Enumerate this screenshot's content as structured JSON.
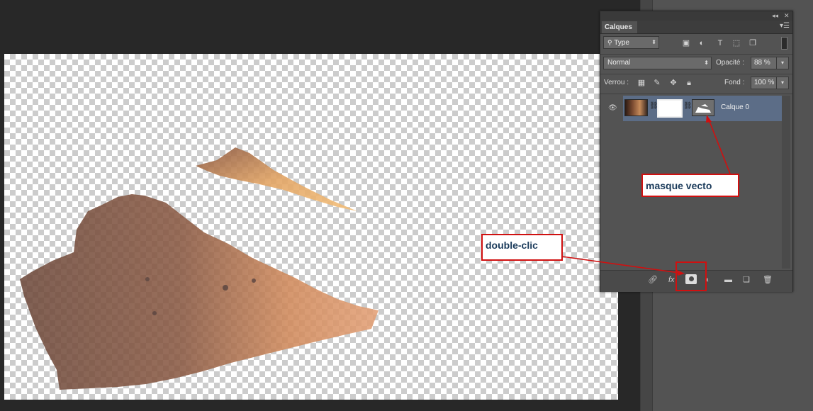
{
  "layers_panel": {
    "tab_label": "Calques",
    "panel_menu_icon": "panel-menu-icon",
    "filter_type": "Type",
    "blend_mode": "Normal",
    "opacity_label": "Opacité :",
    "opacity_value": "88 %",
    "lock_label": "Verrou :",
    "fill_label": "Fond :",
    "fill_value": "100 %",
    "layer": {
      "name": "Calque 0"
    }
  },
  "annotations": {
    "vector_mask": "masque vecto",
    "double_click": "double-clic"
  },
  "colors": {
    "annotation_border": "#d01010",
    "layer_selected": "#5c6d87"
  }
}
